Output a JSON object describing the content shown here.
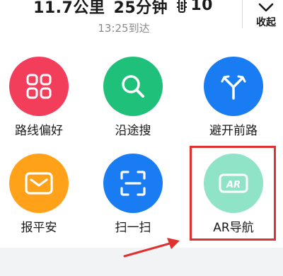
{
  "summary": {
    "distance": "11.7公里",
    "duration": "25分钟",
    "traffic_lights": "10",
    "arrival_time": "13:25到达"
  },
  "collapse": {
    "label": "收起"
  },
  "tiles": [
    {
      "label": "路线偏好",
      "icon": "route-preference-icon",
      "color": "#f23d5b"
    },
    {
      "label": "沿途搜",
      "icon": "search-icon",
      "color": "#1fc07a"
    },
    {
      "label": "避开前路",
      "icon": "fork-arrows-icon",
      "color": "#1a7cf2"
    },
    {
      "label": "报平安",
      "icon": "envelope-icon",
      "color": "#ffa21a"
    },
    {
      "label": "扫一扫",
      "icon": "scan-icon",
      "color": "#1a7cf2"
    },
    {
      "label": "AR导航",
      "icon": "ar-icon",
      "color": "#8fe3c7"
    }
  ]
}
